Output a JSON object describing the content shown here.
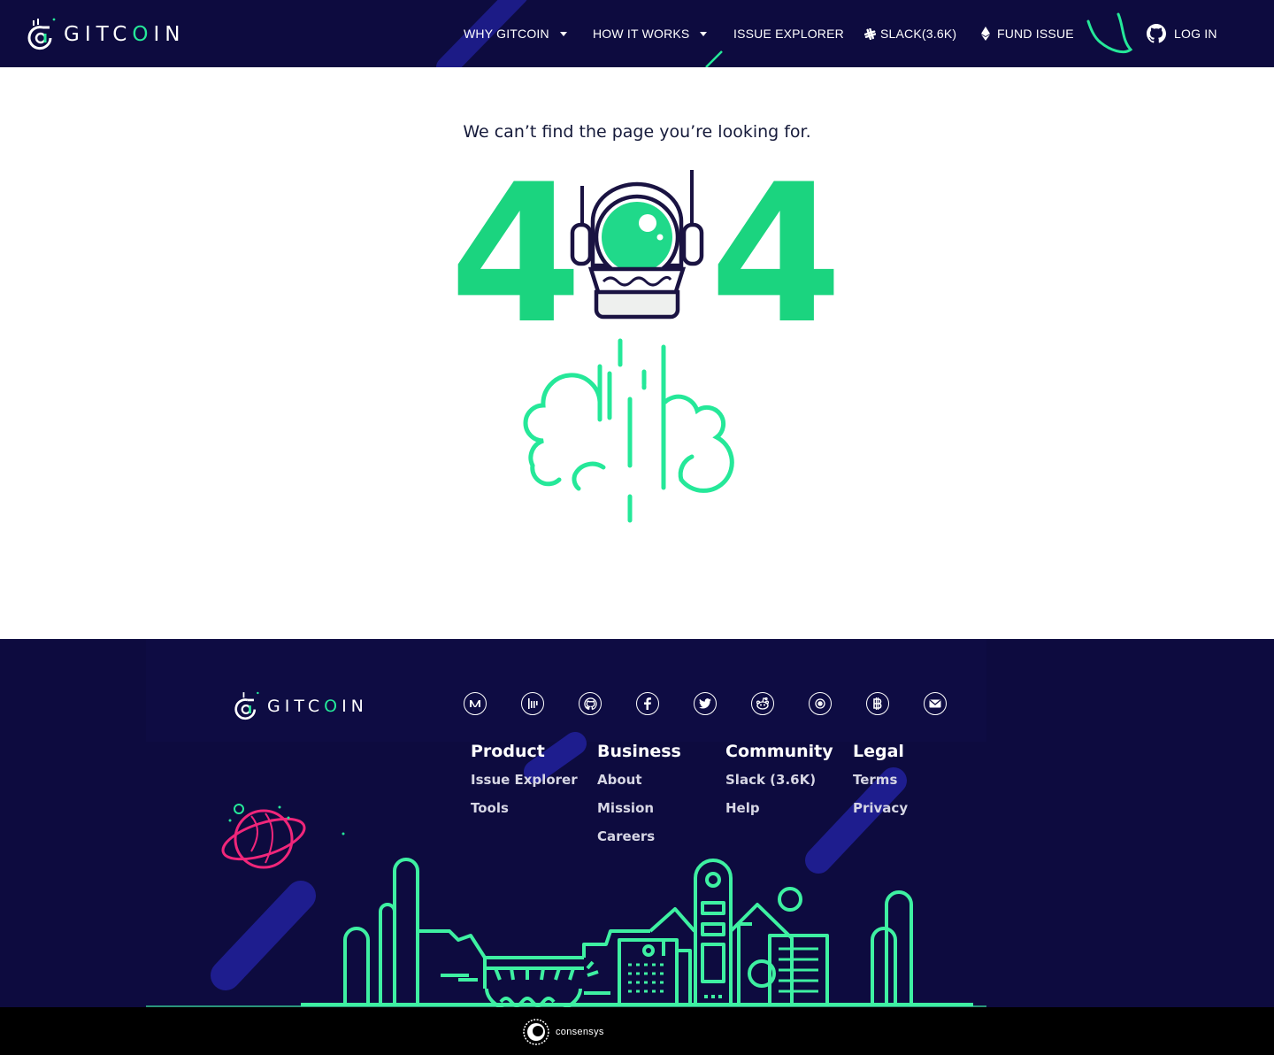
{
  "header": {
    "logo_text": "GITCOIN",
    "nav": {
      "why_gitcoin": "WHY GITCOIN",
      "how_it_works": "HOW IT WORKS",
      "issue_explorer": "ISSUE EXPLORER",
      "slack": "SLACK(3.6K)",
      "fund_issue": "FUND ISSUE",
      "log_in": "LOG IN"
    },
    "icons": [
      "slack-icon",
      "ethereum-icon",
      "github-icon",
      "caret-down-icon"
    ]
  },
  "main": {
    "message": "We can’t find the page you’re looking for.",
    "digit_left": "4",
    "digit_right": "4",
    "illustration": "astronaut-helmet-with-rocket-smoke"
  },
  "footer": {
    "logo_text": "GITCOIN",
    "social_icons": [
      "medium-icon",
      "gitter-icon",
      "github-icon",
      "facebook-icon",
      "twitter-icon",
      "reddit-icon",
      "discourse-icon",
      "bitcoin-icon",
      "email-icon"
    ],
    "columns": [
      {
        "heading": "Product",
        "links": [
          "Issue Explorer",
          "Tools"
        ]
      },
      {
        "heading": "Business",
        "links": [
          "About",
          "Mission",
          "Careers"
        ]
      },
      {
        "heading": "Community",
        "links": [
          "Slack (3.6K)",
          "Help"
        ]
      },
      {
        "heading": "Legal",
        "links": [
          "Terms",
          "Privacy"
        ]
      }
    ],
    "consensys_text": "consensys"
  },
  "colors": {
    "navy": "#0d0b3f",
    "green": "#1bd47f",
    "mint": "#25e899",
    "pink": "#f0267a",
    "black": "#000000"
  }
}
